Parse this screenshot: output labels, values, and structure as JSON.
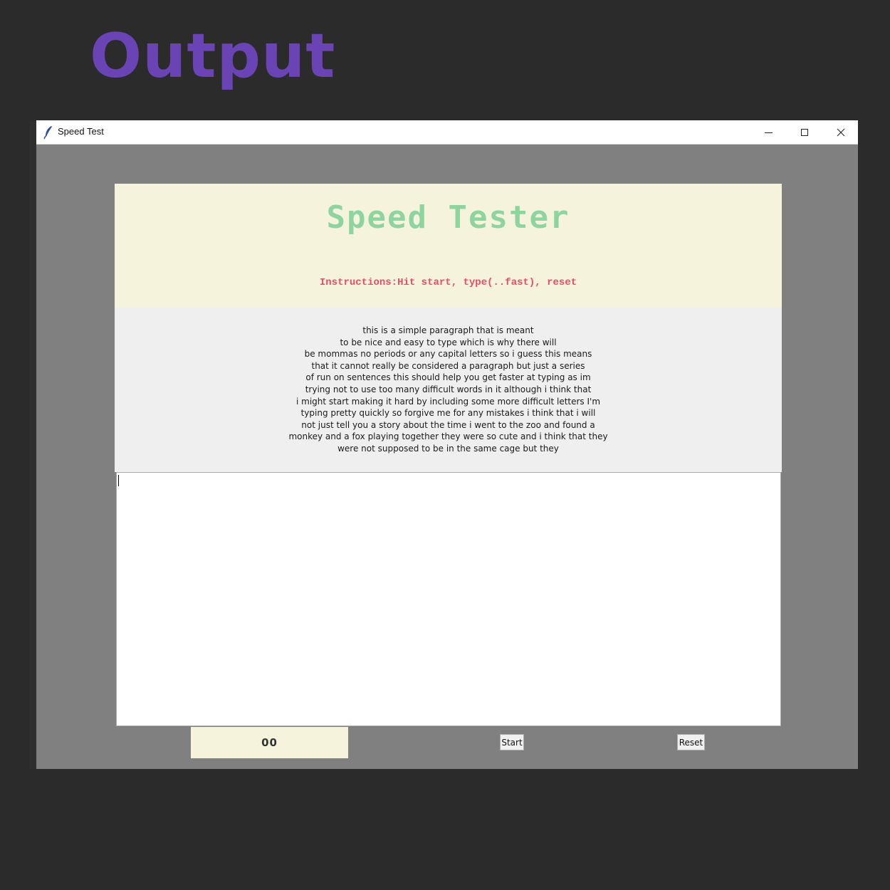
{
  "banner": {
    "heading": "Output"
  },
  "window": {
    "title": "Speed Test",
    "icon": "feather-icon"
  },
  "app": {
    "title": "Speed Tester",
    "instructions": "Instructions:Hit start, type(..fast), reset",
    "paragraph_lines": [
      "this is a simple paragraph that is meant",
      "to be nice and easy to type which is why there will",
      "be mommas no periods or any capital letters so i guess this means",
      "that it cannot really be considered a paragraph but just a series",
      "of run on sentences this should help you get faster at typing as im",
      "trying not to use too many difficult words in it although i think that",
      "i might start making it hard by including some more difficult letters I'm",
      "typing pretty quickly so forgive me for any mistakes i think that i will",
      "not just tell you a story about the time i went to the zoo and found a",
      "monkey and a fox playing together they were so cute and i think that they",
      "were not supposed to be in the same cage but they"
    ],
    "typing_value": "",
    "timer": "00",
    "start_label": "Start",
    "reset_label": "Reset"
  },
  "colors": {
    "heading": "#6a44b4",
    "app_title": "#8ed4a0",
    "instructions": "#e64d66",
    "header_bg": "#f6f3dc",
    "window_bg": "#808080"
  }
}
